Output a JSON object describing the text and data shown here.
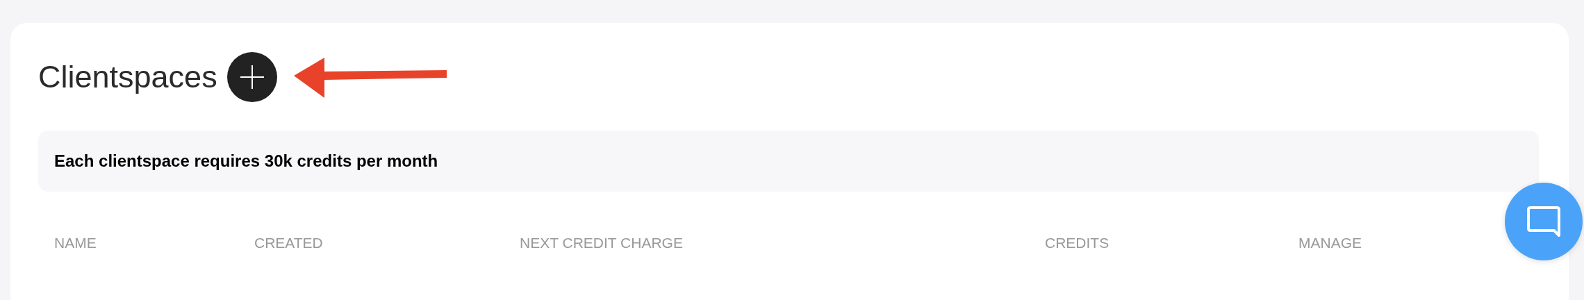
{
  "title": "Clientspaces",
  "notice": "Each clientspace requires 30k credits per month",
  "table": {
    "columns": [
      "NAME",
      "CREATED",
      "NEXT CREDIT CHARGE",
      "CREDITS",
      "MANAGE"
    ]
  }
}
